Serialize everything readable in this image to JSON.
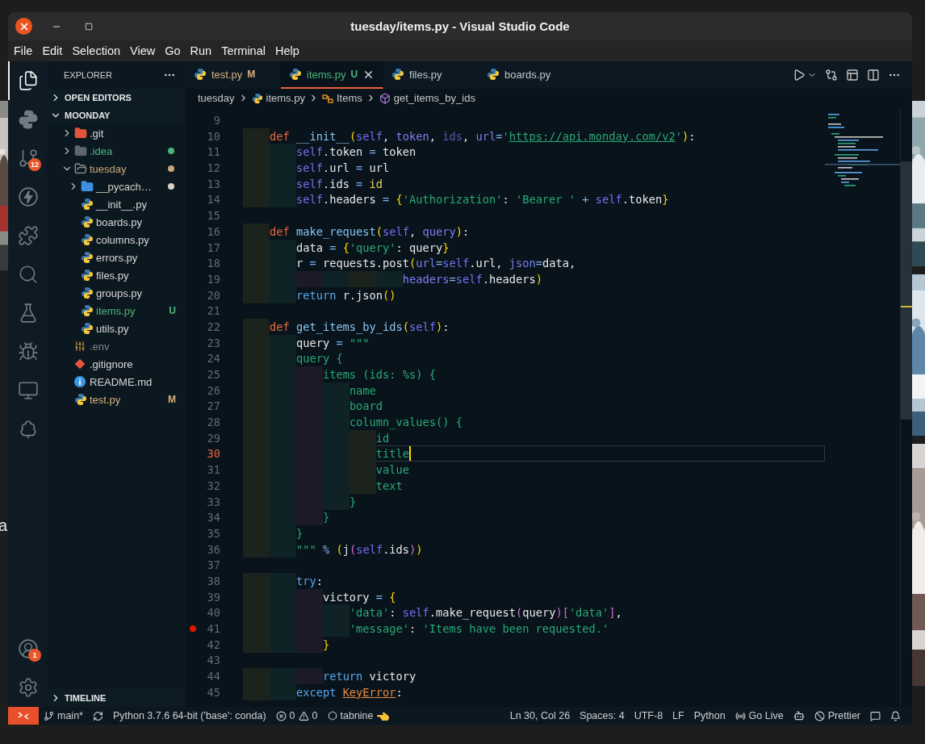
{
  "window": {
    "title": "tuesday/items.py - Visual Studio Code"
  },
  "menu": [
    "File",
    "Edit",
    "Selection",
    "View",
    "Go",
    "Run",
    "Terminal",
    "Help"
  ],
  "activity_bar": {
    "source_control_badge": "12",
    "account_badge": "1"
  },
  "sidebar": {
    "title": "EXPLORER",
    "sections": [
      {
        "label": "OPEN EDITORS",
        "expanded": false
      },
      {
        "label": "MOONDAY",
        "expanded": true,
        "items": [
          {
            "label": ".git",
            "kind": "git-folder",
            "expanded": false
          },
          {
            "label": ".idea",
            "kind": "idea-folder",
            "expanded": false,
            "color": "#4fb47a",
            "dot": true
          },
          {
            "label": "tuesday",
            "kind": "folder",
            "expanded": true,
            "color": "#c9a878",
            "dot": true,
            "children": [
              {
                "label": "__pycach…",
                "kind": "py-folder",
                "expanded": false,
                "color": "#d8d2c4",
                "dot": true
              },
              {
                "label": "__init__.py",
                "kind": "python"
              },
              {
                "label": "boards.py",
                "kind": "python"
              },
              {
                "label": "columns.py",
                "kind": "python"
              },
              {
                "label": "errors.py",
                "kind": "python"
              },
              {
                "label": "files.py",
                "kind": "python"
              },
              {
                "label": "groups.py",
                "kind": "python"
              },
              {
                "label": "items.py",
                "kind": "python",
                "color": "#4fb47a",
                "badge": "U"
              },
              {
                "label": "utils.py",
                "kind": "python"
              }
            ]
          },
          {
            "label": ".env",
            "kind": "env",
            "color": "#7b858c"
          },
          {
            "label": ".gitignore",
            "kind": "gitignore"
          },
          {
            "label": "README.md",
            "kind": "info"
          },
          {
            "label": "test.py",
            "kind": "python",
            "color": "#d8b07a",
            "badge": "M"
          }
        ]
      }
    ],
    "timeline": {
      "label": "TIMELINE",
      "expanded": false
    }
  },
  "tabs": [
    {
      "label": "test.py",
      "badge": "M",
      "color": "#d8b07a",
      "selected": false
    },
    {
      "label": "items.py",
      "badge": "U",
      "color": "#4fb47a",
      "selected": true
    },
    {
      "label": "files.py",
      "selected": false
    },
    {
      "label": "boards.py",
      "selected": false
    }
  ],
  "breadcrumb": [
    {
      "kind": "folder",
      "text": "tuesday"
    },
    {
      "kind": "file",
      "text": "items.py"
    },
    {
      "kind": "class",
      "text": "Items"
    },
    {
      "kind": "method",
      "text": "get_items_by_ids"
    }
  ],
  "editor": {
    "lines": [
      {
        "number": "9",
        "current": false,
        "breakpoint": false
      },
      {
        "number": "10",
        "current": false,
        "breakpoint": false,
        "tokens": [
          {
            "kind": "kw",
            "text": "    def "
          },
          {
            "kind": "fn",
            "text": "__init__"
          },
          {
            "kind": "b1",
            "text": "("
          },
          {
            "kind": "self",
            "text": "self"
          },
          {
            "kind": "plain",
            "text": ", "
          },
          {
            "kind": "param",
            "text": "token"
          },
          {
            "kind": "plain",
            "text": ", "
          },
          {
            "kind": "paramdim",
            "text": "ids"
          },
          {
            "kind": "plain",
            "text": ", "
          },
          {
            "kind": "param",
            "text": "url"
          },
          {
            "kind": "op",
            "text": "="
          },
          {
            "kind": "str",
            "text": "'"
          },
          {
            "kind": "link",
            "text": "https://api.monday.com/v2"
          },
          {
            "kind": "str",
            "text": "'"
          },
          {
            "kind": "b1",
            "text": ")"
          },
          {
            "kind": "plain",
            "text": ":"
          }
        ]
      },
      {
        "number": "11",
        "current": false,
        "breakpoint": false,
        "tokens": [
          {
            "kind": "self",
            "text": "        self"
          },
          {
            "kind": "plain",
            "text": ".token "
          },
          {
            "kind": "op",
            "text": "="
          },
          {
            "kind": "plain",
            "text": " token"
          }
        ]
      },
      {
        "number": "12",
        "current": false,
        "breakpoint": false,
        "tokens": [
          {
            "kind": "self",
            "text": "        self"
          },
          {
            "kind": "plain",
            "text": ".url "
          },
          {
            "kind": "op",
            "text": "="
          },
          {
            "kind": "plain",
            "text": " url"
          }
        ]
      },
      {
        "number": "13",
        "current": false,
        "breakpoint": false,
        "tokens": [
          {
            "kind": "self",
            "text": "        self"
          },
          {
            "kind": "plain",
            "text": ".ids "
          },
          {
            "kind": "op",
            "text": "= "
          },
          {
            "kind": "builtin",
            "text": "id"
          }
        ]
      },
      {
        "number": "14",
        "current": false,
        "breakpoint": false,
        "tokens": [
          {
            "kind": "self",
            "text": "        self"
          },
          {
            "kind": "plain",
            "text": ".headers "
          },
          {
            "kind": "op",
            "text": "= "
          },
          {
            "kind": "b1",
            "text": "{"
          },
          {
            "kind": "str",
            "text": "'Authorization'"
          },
          {
            "kind": "plain",
            "text": ": "
          },
          {
            "kind": "str",
            "text": "'Bearer '"
          },
          {
            "kind": "op",
            "text": " + "
          },
          {
            "kind": "self",
            "text": "self"
          },
          {
            "kind": "plain",
            "text": ".token"
          },
          {
            "kind": "b1",
            "text": "}"
          }
        ]
      },
      {
        "number": "15",
        "current": false,
        "breakpoint": false
      },
      {
        "number": "16",
        "current": false,
        "breakpoint": false,
        "tokens": [
          {
            "kind": "kw",
            "text": "    def "
          },
          {
            "kind": "fn",
            "text": "make_request"
          },
          {
            "kind": "b1",
            "text": "("
          },
          {
            "kind": "self",
            "text": "self"
          },
          {
            "kind": "plain",
            "text": ", "
          },
          {
            "kind": "param",
            "text": "query"
          },
          {
            "kind": "b1",
            "text": ")"
          },
          {
            "kind": "plain",
            "text": ":"
          }
        ]
      },
      {
        "number": "17",
        "current": false,
        "breakpoint": false,
        "tokens": [
          {
            "kind": "plain",
            "text": "        data "
          },
          {
            "kind": "op",
            "text": "= "
          },
          {
            "kind": "b1",
            "text": "{"
          },
          {
            "kind": "str",
            "text": "'query'"
          },
          {
            "kind": "plain",
            "text": ": query"
          },
          {
            "kind": "b1",
            "text": "}"
          }
        ]
      },
      {
        "number": "18",
        "current": false,
        "breakpoint": false,
        "tokens": [
          {
            "kind": "plain",
            "text": "        r "
          },
          {
            "kind": "op",
            "text": "="
          },
          {
            "kind": "plain",
            "text": " requests.post"
          },
          {
            "kind": "b1",
            "text": "("
          },
          {
            "kind": "param",
            "text": "url"
          },
          {
            "kind": "op",
            "text": "="
          },
          {
            "kind": "self",
            "text": "self"
          },
          {
            "kind": "plain",
            "text": ".url, "
          },
          {
            "kind": "param",
            "text": "json"
          },
          {
            "kind": "op",
            "text": "="
          },
          {
            "kind": "plain",
            "text": "data,"
          }
        ]
      },
      {
        "number": "19",
        "current": false,
        "breakpoint": false,
        "tokens": [
          {
            "kind": "param",
            "text": "                        headers"
          },
          {
            "kind": "op",
            "text": "="
          },
          {
            "kind": "self",
            "text": "self"
          },
          {
            "kind": "plain",
            "text": ".headers"
          },
          {
            "kind": "b1",
            "text": ")"
          }
        ]
      },
      {
        "number": "20",
        "current": false,
        "breakpoint": false,
        "tokens": [
          {
            "kind": "ctl",
            "text": "        return"
          },
          {
            "kind": "plain",
            "text": " r.json"
          },
          {
            "kind": "b1",
            "text": "()"
          }
        ]
      },
      {
        "number": "21",
        "current": false,
        "breakpoint": false
      },
      {
        "number": "22",
        "current": false,
        "breakpoint": false,
        "tokens": [
          {
            "kind": "kw",
            "text": "    def "
          },
          {
            "kind": "fn",
            "text": "get_items_by_ids"
          },
          {
            "kind": "b1",
            "text": "("
          },
          {
            "kind": "self",
            "text": "self"
          },
          {
            "kind": "b1",
            "text": ")"
          },
          {
            "kind": "plain",
            "text": ":"
          }
        ]
      },
      {
        "number": "23",
        "current": false,
        "breakpoint": false,
        "tokens": [
          {
            "kind": "plain",
            "text": "        query "
          },
          {
            "kind": "op",
            "text": "= "
          },
          {
            "kind": "str",
            "text": "\"\"\""
          }
        ]
      },
      {
        "number": "24",
        "current": false,
        "breakpoint": false,
        "tokens": [
          {
            "kind": "str",
            "text": "        query {"
          }
        ]
      },
      {
        "number": "25",
        "current": false,
        "breakpoint": false,
        "tokens": [
          {
            "kind": "str",
            "text": "            items (ids: %s) {"
          }
        ]
      },
      {
        "number": "26",
        "current": false,
        "breakpoint": false,
        "tokens": [
          {
            "kind": "str",
            "text": "                name"
          }
        ]
      },
      {
        "number": "27",
        "current": false,
        "breakpoint": false,
        "tokens": [
          {
            "kind": "str",
            "text": "                board"
          }
        ]
      },
      {
        "number": "28",
        "current": false,
        "breakpoint": false,
        "tokens": [
          {
            "kind": "str",
            "text": "                column_values() {"
          }
        ]
      },
      {
        "number": "29",
        "current": false,
        "breakpoint": false,
        "tokens": [
          {
            "kind": "str",
            "text": "                    id"
          }
        ]
      },
      {
        "number": "30",
        "current": true,
        "breakpoint": false,
        "tokens": [
          {
            "kind": "str",
            "text": "                    title"
          }
        ]
      },
      {
        "number": "31",
        "current": false,
        "breakpoint": false,
        "tokens": [
          {
            "kind": "str",
            "text": "                    value"
          }
        ]
      },
      {
        "number": "32",
        "current": false,
        "breakpoint": false,
        "tokens": [
          {
            "kind": "str",
            "text": "                    text"
          }
        ]
      },
      {
        "number": "33",
        "current": false,
        "breakpoint": false,
        "tokens": [
          {
            "kind": "str",
            "text": "                }"
          }
        ]
      },
      {
        "number": "34",
        "current": false,
        "breakpoint": false,
        "tokens": [
          {
            "kind": "str",
            "text": "            }"
          }
        ]
      },
      {
        "number": "35",
        "current": false,
        "breakpoint": false,
        "tokens": [
          {
            "kind": "str",
            "text": "        }"
          }
        ]
      },
      {
        "number": "36",
        "current": false,
        "breakpoint": false,
        "tokens": [
          {
            "kind": "str",
            "text": "        \"\"\""
          },
          {
            "kind": "op",
            "text": " % "
          },
          {
            "kind": "b1",
            "text": "("
          },
          {
            "kind": "plain",
            "text": "j"
          },
          {
            "kind": "b2",
            "text": "("
          },
          {
            "kind": "self",
            "text": "self"
          },
          {
            "kind": "plain",
            "text": ".ids"
          },
          {
            "kind": "b2",
            "text": ")"
          },
          {
            "kind": "b1",
            "text": ")"
          }
        ]
      },
      {
        "number": "37",
        "current": false,
        "breakpoint": false
      },
      {
        "number": "38",
        "current": false,
        "breakpoint": false,
        "tokens": [
          {
            "kind": "ctl",
            "text": "        try"
          },
          {
            "kind": "plain",
            "text": ":"
          }
        ]
      },
      {
        "number": "39",
        "current": false,
        "breakpoint": false,
        "tokens": [
          {
            "kind": "plain",
            "text": "            victory "
          },
          {
            "kind": "op",
            "text": "= "
          },
          {
            "kind": "b1",
            "text": "{"
          }
        ]
      },
      {
        "number": "40",
        "current": false,
        "breakpoint": false,
        "tokens": [
          {
            "kind": "str",
            "text": "                'data'"
          },
          {
            "kind": "plain",
            "text": ": "
          },
          {
            "kind": "self",
            "text": "self"
          },
          {
            "kind": "plain",
            "text": ".make_request"
          },
          {
            "kind": "b2",
            "text": "("
          },
          {
            "kind": "plain",
            "text": "query"
          },
          {
            "kind": "b2",
            "text": ")"
          },
          {
            "kind": "b2",
            "text": "["
          },
          {
            "kind": "str",
            "text": "'data'"
          },
          {
            "kind": "b2",
            "text": "]"
          },
          {
            "kind": "plain",
            "text": ","
          }
        ]
      },
      {
        "number": "41",
        "current": false,
        "breakpoint": true,
        "tokens": [
          {
            "kind": "str",
            "text": "                'message'"
          },
          {
            "kind": "plain",
            "text": ": "
          },
          {
            "kind": "str",
            "text": "'Items have been requested.'"
          }
        ]
      },
      {
        "number": "42",
        "current": false,
        "breakpoint": false,
        "tokens": [
          {
            "kind": "b1",
            "text": "            }"
          }
        ]
      },
      {
        "number": "43",
        "current": false,
        "breakpoint": false
      },
      {
        "number": "44",
        "current": false,
        "breakpoint": false,
        "tokens": [
          {
            "kind": "ctl",
            "text": "            return"
          },
          {
            "kind": "plain",
            "text": " victory"
          }
        ]
      },
      {
        "number": "45",
        "current": false,
        "breakpoint": false,
        "tokens": [
          {
            "kind": "ctl",
            "text": "        except "
          },
          {
            "kind": "cls",
            "text": "KeyError"
          },
          {
            "kind": "plain",
            "text": ":"
          }
        ]
      }
    ]
  },
  "status_bar": {
    "branch": "main*",
    "interpreter": "Python 3.7.6 64-bit ('base': conda)",
    "errors": "0",
    "warnings": "0",
    "tabnine": "tabnine",
    "cursor": "Ln 30, Col 26",
    "indentation": "Spaces: 4",
    "encoding": "UTF-8",
    "eol": "LF",
    "language": "Python",
    "live": "Go Live",
    "formatter": "Prettier"
  },
  "desktop": {
    "background_text": "a"
  }
}
